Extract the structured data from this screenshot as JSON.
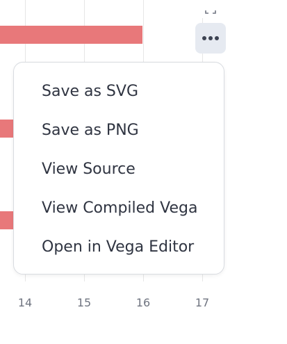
{
  "chart_data": {
    "type": "bar",
    "x_ticks": [
      "14",
      "15",
      "16",
      "17"
    ],
    "bar_color": "#e8787a",
    "grid": true
  },
  "toolbar": {
    "fullscreen_icon": "fullscreen-icon",
    "more_icon": "more-horizontal-icon"
  },
  "menu": {
    "items": [
      "Save as SVG",
      "Save as PNG",
      "View Source",
      "View Compiled Vega",
      "Open in Vega Editor"
    ]
  }
}
